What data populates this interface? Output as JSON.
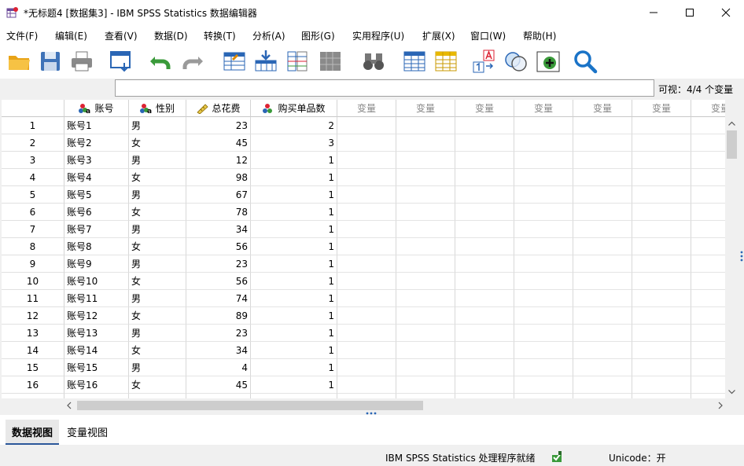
{
  "window": {
    "title": "*无标题4 [数据集3] - IBM SPSS Statistics 数据编辑器"
  },
  "menu": [
    "文件(F)",
    "编辑(E)",
    "查看(V)",
    "数据(D)",
    "转换(T)",
    "分析(A)",
    "图形(G)",
    "实用程序(U)",
    "扩展(X)",
    "窗口(W)",
    "帮助(H)"
  ],
  "cell_editor": {
    "value": "",
    "visible_label": "可视：4/4 个变量"
  },
  "columns": [
    "账号",
    "性别",
    "总花费",
    "购买单品数"
  ],
  "empty_column_label": "变量",
  "rows": [
    {
      "n": "1",
      "acct": "账号1",
      "gender": "男",
      "spend": "23",
      "items": "2"
    },
    {
      "n": "2",
      "acct": "账号2",
      "gender": "女",
      "spend": "45",
      "items": "3"
    },
    {
      "n": "3",
      "acct": "账号3",
      "gender": "男",
      "spend": "12",
      "items": "1"
    },
    {
      "n": "4",
      "acct": "账号4",
      "gender": "女",
      "spend": "98",
      "items": "1"
    },
    {
      "n": "5",
      "acct": "账号5",
      "gender": "男",
      "spend": "67",
      "items": "1"
    },
    {
      "n": "6",
      "acct": "账号6",
      "gender": "女",
      "spend": "78",
      "items": "1"
    },
    {
      "n": "7",
      "acct": "账号7",
      "gender": "男",
      "spend": "34",
      "items": "1"
    },
    {
      "n": "8",
      "acct": "账号8",
      "gender": "女",
      "spend": "56",
      "items": "1"
    },
    {
      "n": "9",
      "acct": "账号9",
      "gender": "男",
      "spend": "23",
      "items": "1"
    },
    {
      "n": "10",
      "acct": "账号10",
      "gender": "女",
      "spend": "56",
      "items": "1"
    },
    {
      "n": "11",
      "acct": "账号11",
      "gender": "男",
      "spend": "74",
      "items": "1"
    },
    {
      "n": "12",
      "acct": "账号12",
      "gender": "女",
      "spend": "89",
      "items": "1"
    },
    {
      "n": "13",
      "acct": "账号13",
      "gender": "男",
      "spend": "23",
      "items": "1"
    },
    {
      "n": "14",
      "acct": "账号14",
      "gender": "女",
      "spend": "34",
      "items": "1"
    },
    {
      "n": "15",
      "acct": "账号15",
      "gender": "男",
      "spend": "4",
      "items": "1"
    },
    {
      "n": "16",
      "acct": "账号16",
      "gender": "女",
      "spend": "45",
      "items": "1"
    }
  ],
  "tabs": [
    "数据视图",
    "变量视图"
  ],
  "status": {
    "processor": "IBM SPSS Statistics 处理程序就绪",
    "unicode": "Unicode：开"
  },
  "colors": {
    "accent": "#1a73c7",
    "tab_underline": "#2b579a",
    "scroll_thumb": "#cdcdcd"
  }
}
